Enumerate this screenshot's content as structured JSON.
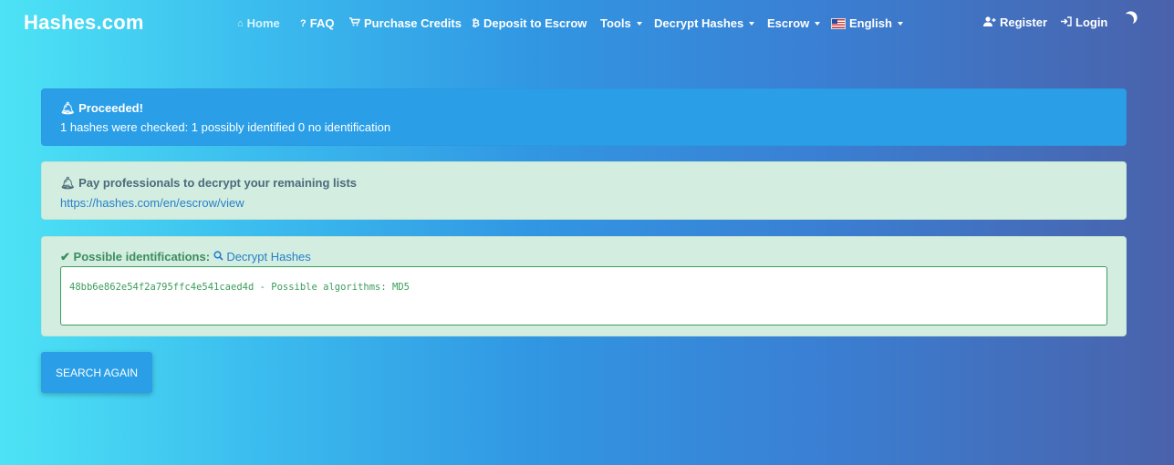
{
  "brand": "Hashes.com",
  "nav": {
    "home": "Home",
    "faq": "FAQ",
    "purchase": "Purchase Credits",
    "deposit": "Deposit to Escrow",
    "tools": "Tools",
    "decrypt": "Decrypt Hashes",
    "escrow": "Escrow",
    "language": "English",
    "register": "Register",
    "login": "Login"
  },
  "alert_info": {
    "title": "Proceeded!",
    "message": "1 hashes were checked: 1 possibly identified 0 no identification"
  },
  "alert_promo": {
    "title": "Pay professionals to decrypt your remaining lists",
    "link": "https://hashes.com/en/escrow/view"
  },
  "result": {
    "label": "Possible identifications:",
    "decrypt_link": "Decrypt Hashes",
    "output": "48bb6e862e54f2a795ffc4e541caed4d - Possible algorithms: MD5"
  },
  "search_again": "SEARCH AGAIN",
  "icons": {
    "home": "home-icon",
    "faq": "question-icon",
    "purchase": "cart-icon",
    "deposit": "bitcoin-icon",
    "language": "us-flag-icon",
    "register": "user-plus-icon",
    "login": "sign-in-icon",
    "theme": "moon-icon",
    "bell": "bell-icon",
    "check": "check-icon",
    "search": "search-icon"
  }
}
